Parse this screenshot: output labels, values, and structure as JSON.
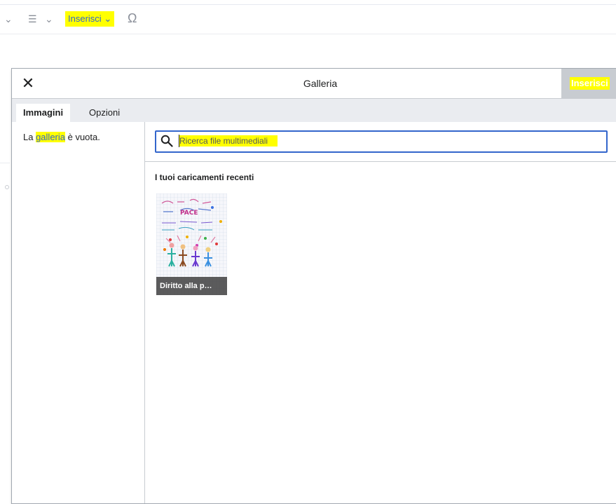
{
  "toolbar": {
    "chevron": "⌄",
    "list_icon": "☰",
    "insert_label": "Inserisci",
    "insert_caret": "⌄",
    "special_chars": "Ω"
  },
  "dialog": {
    "close_icon": "✕",
    "title": "Galleria",
    "action_label": "Inserisci",
    "tabs": [
      {
        "label": "Immagini",
        "active": true
      },
      {
        "label": "Opzioni",
        "active": false
      }
    ],
    "empty_message": {
      "before": "La ",
      "highlight": "galleria",
      "after": " è vuota."
    },
    "search": {
      "placeholder": "Ricerca file multimediali",
      "icon": "search-icon"
    },
    "recent_uploads_title": "I tuoi caricamenti recenti",
    "recent_items": [
      {
        "caption": "Diritto alla p…"
      }
    ]
  },
  "colors": {
    "highlight": "#ffff00",
    "link": "#3366cc",
    "focus_border": "#3366cc",
    "action_button_bg": "#c8ccd1",
    "tab_bar_bg": "#eaecf0"
  }
}
